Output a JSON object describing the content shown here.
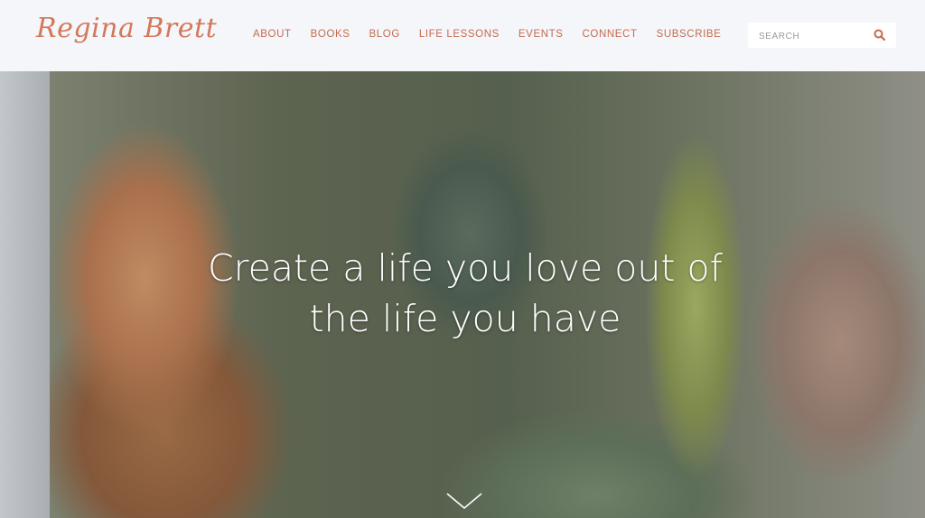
{
  "brand": {
    "logo_text": "Regina Brett"
  },
  "nav": {
    "items": [
      {
        "label": "ABOUT"
      },
      {
        "label": "BOOKS"
      },
      {
        "label": "BLOG"
      },
      {
        "label": "LIFE LESSONS"
      },
      {
        "label": "EVENTS"
      },
      {
        "label": "CONNECT"
      },
      {
        "label": "SUBSCRIBE"
      }
    ]
  },
  "search": {
    "placeholder": "SEARCH",
    "value": ""
  },
  "hero": {
    "headline_line1": "Create a life you love out of",
    "headline_line2": "the life you have"
  },
  "colors": {
    "accent": "#c66a4e",
    "header_bg": "#f4f6fa",
    "hero_text": "#ffffff"
  },
  "icons": {
    "search": "search-icon",
    "scroll": "chevron-down-icon"
  }
}
